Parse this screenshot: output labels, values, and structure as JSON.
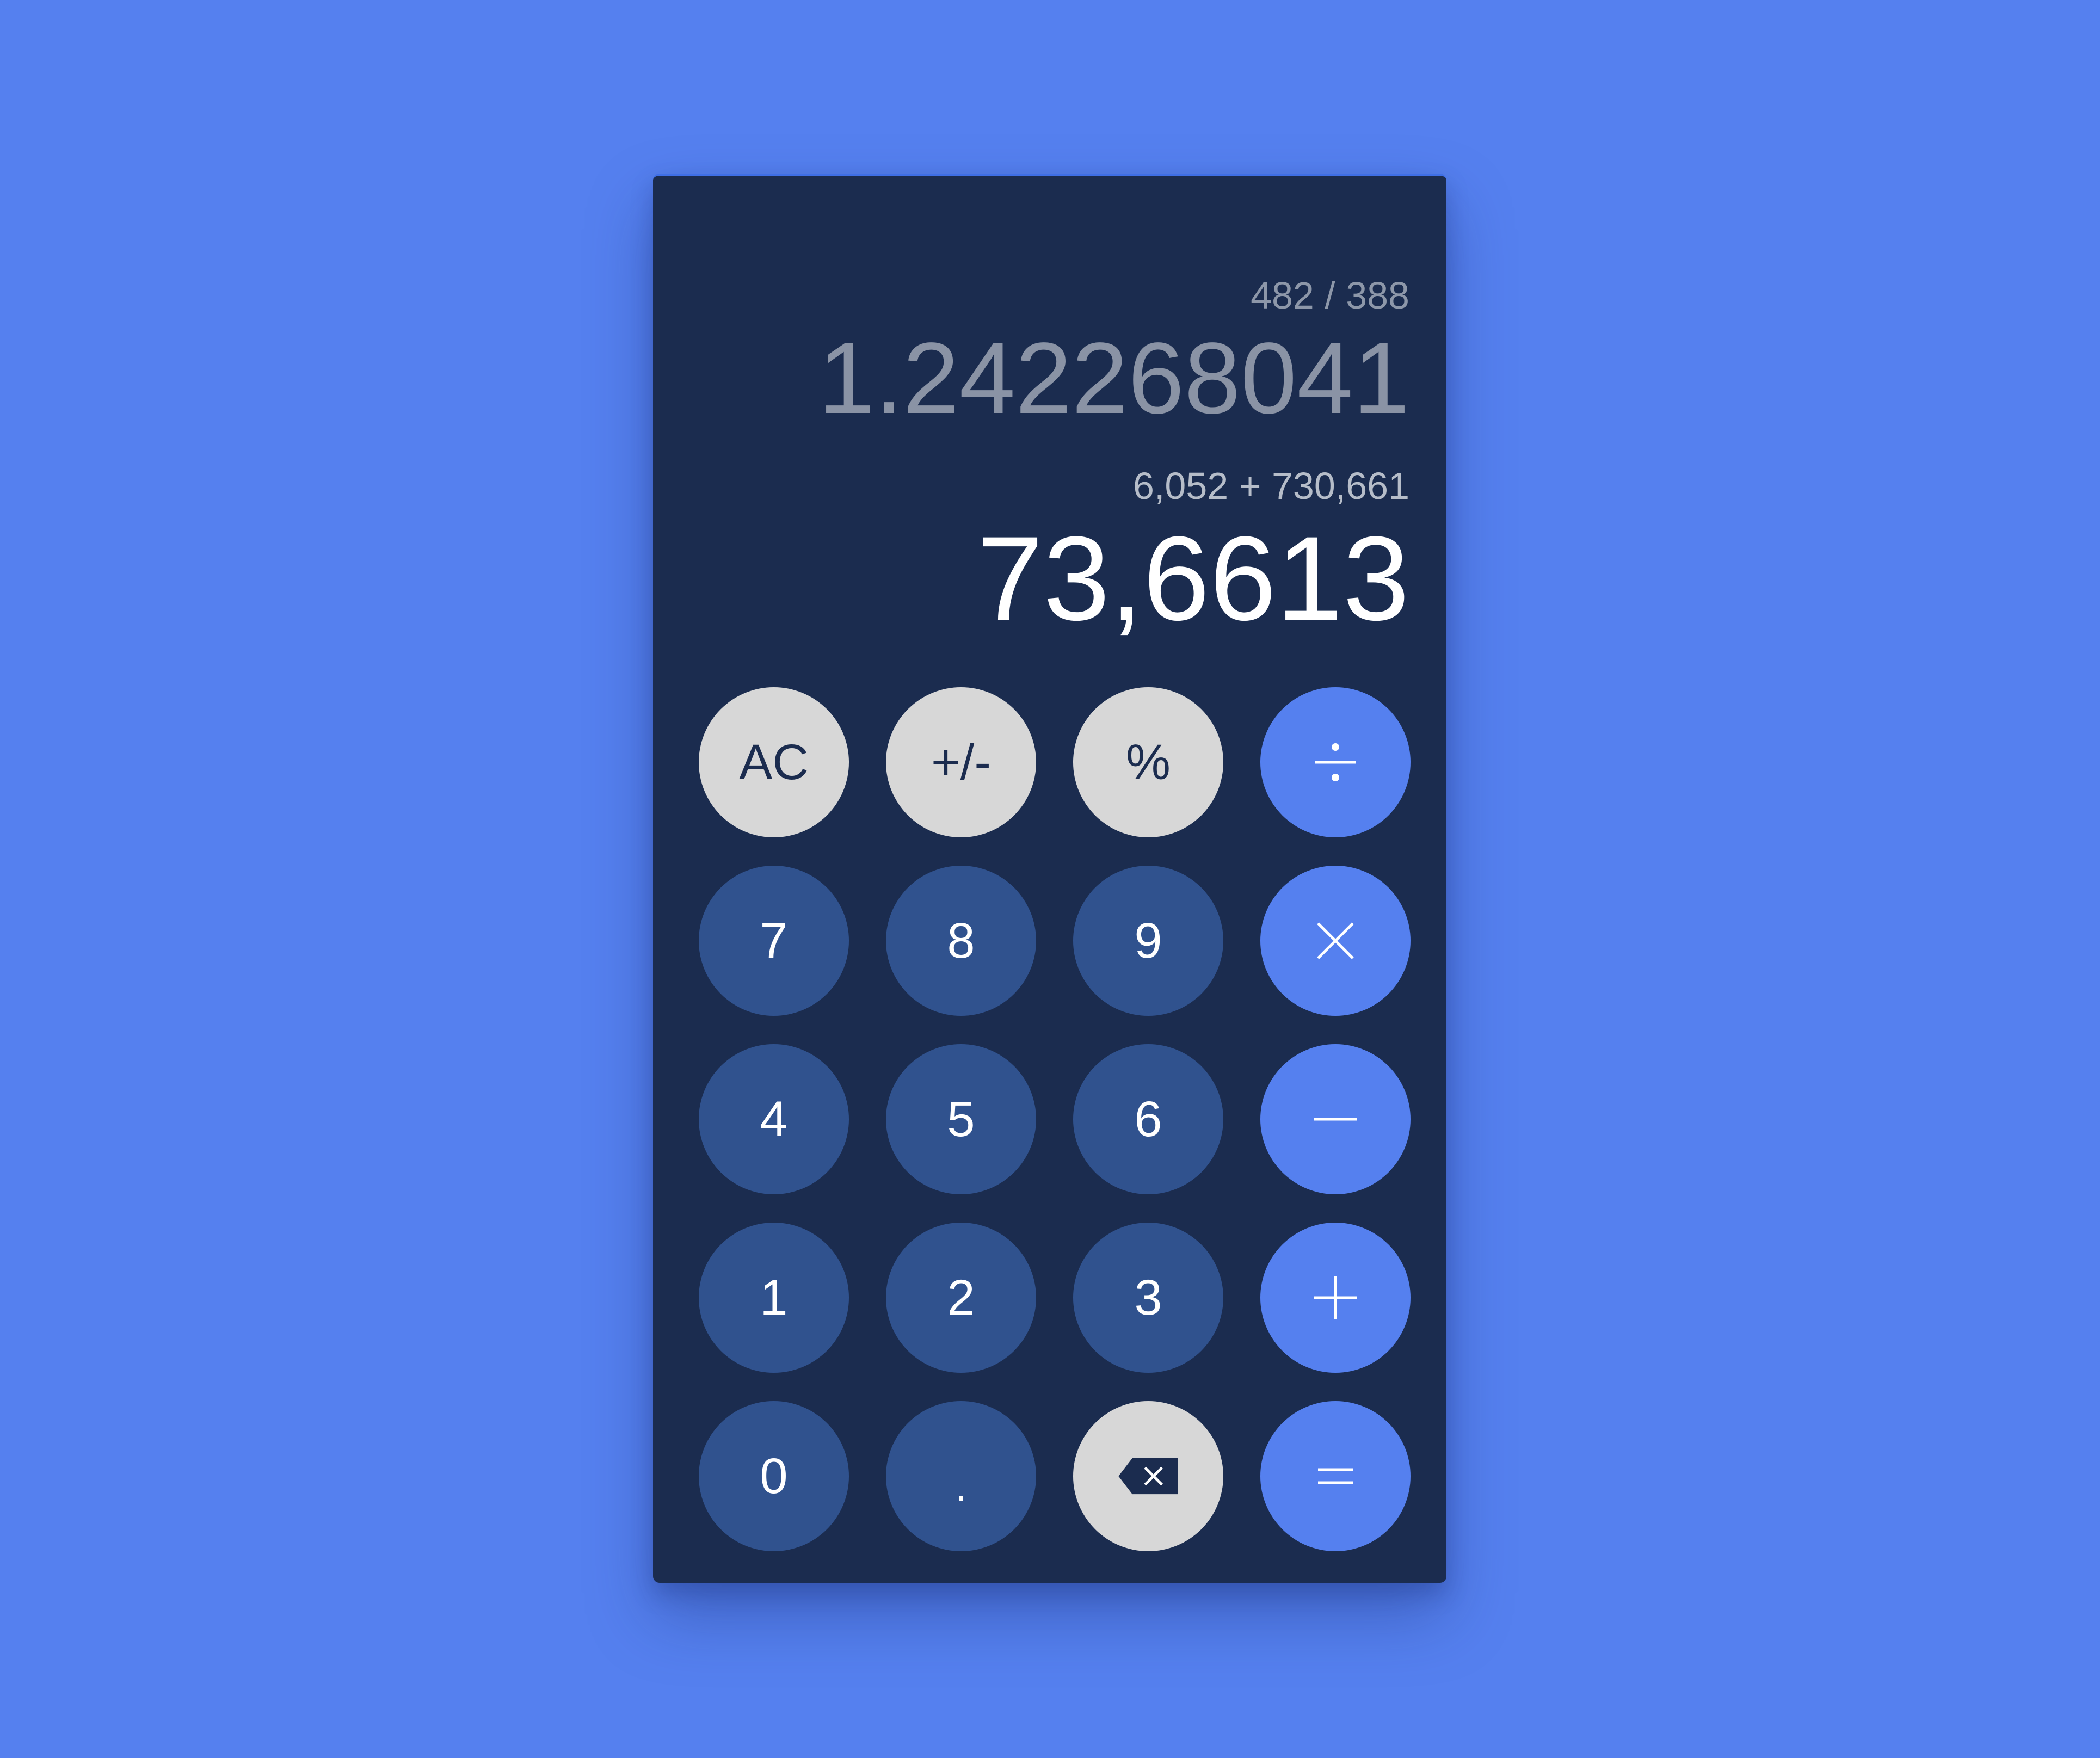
{
  "display": {
    "history_expression": "482 / 388",
    "history_result": "1.242268041",
    "current_expression": "6,052 + 730,661",
    "current_result": "73,6613"
  },
  "keypad": {
    "clear_label": "AC",
    "sign_label": "+/-",
    "percent_label": "%",
    "digit_7": "7",
    "digit_8": "8",
    "digit_9": "9",
    "digit_4": "4",
    "digit_5": "5",
    "digit_6": "6",
    "digit_1": "1",
    "digit_2": "2",
    "digit_3": "3",
    "digit_0": "0",
    "decimal_label": ".",
    "divide_icon": "divide-icon",
    "multiply_icon": "multiply-icon",
    "subtract_icon": "minus-icon",
    "add_icon": "plus-icon",
    "equals_icon": "equals-icon",
    "backspace_icon": "backspace-icon"
  },
  "colors": {
    "background": "#5580ef",
    "panel": "#1b2c4f",
    "digit_button": "#30528e",
    "function_button": "#d7d7d7",
    "operator_button": "#5580ef"
  }
}
